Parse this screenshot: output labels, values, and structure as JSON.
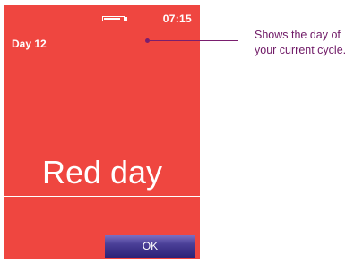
{
  "status": {
    "time": "07:15",
    "battery_icon": "battery-icon",
    "battery_level": 0.85
  },
  "cycle": {
    "day_label": "Day 12"
  },
  "main": {
    "message": "Red day"
  },
  "actions": {
    "ok_label": "OK"
  },
  "callout": {
    "text": "Shows the day of your current cycle."
  },
  "colors": {
    "screen_bg": "#ef4640",
    "text": "#ffffff",
    "button": "#3b3189",
    "callout": "#7a1e6e"
  }
}
